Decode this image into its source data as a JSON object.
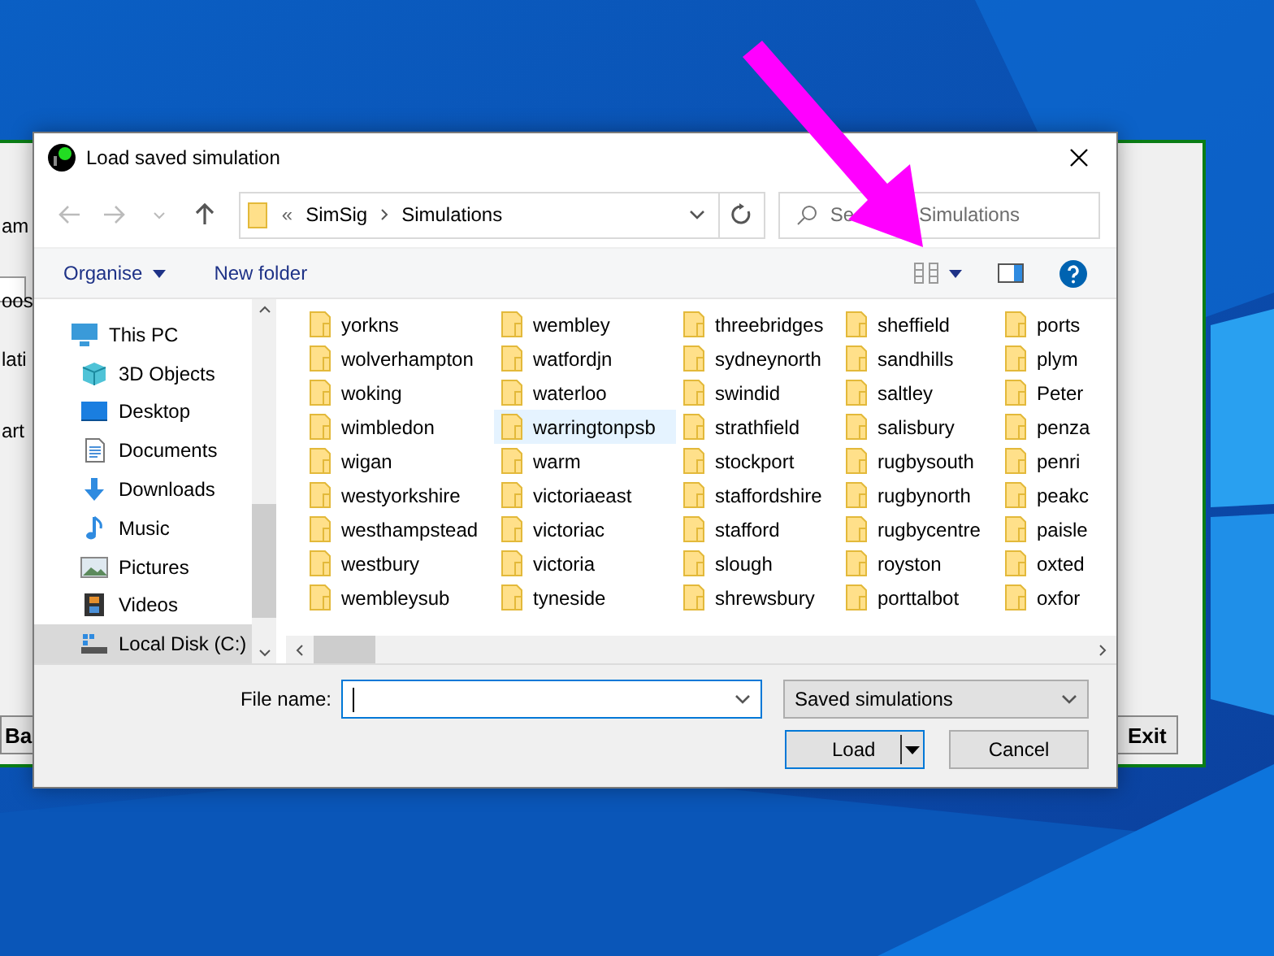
{
  "background_window": {
    "fragments": [
      "am",
      "oos",
      "lati",
      "art"
    ],
    "buttons": [
      "Ba",
      "Exit"
    ]
  },
  "dialog": {
    "title": "Load saved simulation",
    "address": {
      "prefix": "«",
      "path": [
        "SimSig",
        "Simulations"
      ]
    },
    "search": {
      "placeholder": [
        "Se",
        "Simulations"
      ]
    },
    "toolbar": {
      "organise": "Organise",
      "new_folder": "New folder"
    },
    "navigation": [
      {
        "label": "This PC",
        "kind": "pc",
        "selected": false,
        "children": [
          {
            "label": "3D Objects",
            "kind": "objects",
            "selected": false
          },
          {
            "label": "Desktop",
            "kind": "desktop",
            "selected": false
          },
          {
            "label": "Documents",
            "kind": "documents",
            "selected": false
          },
          {
            "label": "Downloads",
            "kind": "downloads",
            "selected": false
          },
          {
            "label": "Music",
            "kind": "music",
            "selected": false
          },
          {
            "label": "Pictures",
            "kind": "pictures",
            "selected": false
          },
          {
            "label": "Videos",
            "kind": "videos",
            "selected": false
          },
          {
            "label": "Local Disk (C:)",
            "kind": "disk",
            "selected": true
          }
        ]
      }
    ],
    "folders": [
      {
        "name": "yorkns",
        "highlighted": false
      },
      {
        "name": "wolverhampton",
        "highlighted": false
      },
      {
        "name": "woking",
        "highlighted": false
      },
      {
        "name": "wimbledon",
        "highlighted": false
      },
      {
        "name": "wigan",
        "highlighted": false
      },
      {
        "name": "westyorkshire",
        "highlighted": false
      },
      {
        "name": "westhampstead",
        "highlighted": false
      },
      {
        "name": "westbury",
        "highlighted": false
      },
      {
        "name": "wembleysub",
        "highlighted": false
      },
      {
        "name": "wembley",
        "highlighted": false
      },
      {
        "name": "watfordjn",
        "highlighted": false
      },
      {
        "name": "waterloo",
        "highlighted": false
      },
      {
        "name": "warringtonpsb",
        "highlighted": true
      },
      {
        "name": "warm",
        "highlighted": false
      },
      {
        "name": "victoriaeast",
        "highlighted": false
      },
      {
        "name": "victoriac",
        "highlighted": false
      },
      {
        "name": "victoria",
        "highlighted": false
      },
      {
        "name": "tyneside",
        "highlighted": false
      },
      {
        "name": "threebridges",
        "highlighted": false
      },
      {
        "name": "sydneynorth",
        "highlighted": false
      },
      {
        "name": "swindid",
        "highlighted": false
      },
      {
        "name": "strathfield",
        "highlighted": false
      },
      {
        "name": "stockport",
        "highlighted": false
      },
      {
        "name": "staffordshire",
        "highlighted": false
      },
      {
        "name": "stafford",
        "highlighted": false
      },
      {
        "name": "slough",
        "highlighted": false
      },
      {
        "name": "shrewsbury",
        "highlighted": false
      },
      {
        "name": "sheffield",
        "highlighted": false
      },
      {
        "name": "sandhills",
        "highlighted": false
      },
      {
        "name": "saltley",
        "highlighted": false
      },
      {
        "name": "salisbury",
        "highlighted": false
      },
      {
        "name": "rugbysouth",
        "highlighted": false
      },
      {
        "name": "rugbynorth",
        "highlighted": false
      },
      {
        "name": "rugbycentre",
        "highlighted": false
      },
      {
        "name": "royston",
        "highlighted": false
      },
      {
        "name": "porttalbot",
        "highlighted": false
      },
      {
        "name": "ports",
        "highlighted": false
      },
      {
        "name": "plym",
        "highlighted": false
      },
      {
        "name": "Peter",
        "highlighted": false
      },
      {
        "name": "penza",
        "highlighted": false
      },
      {
        "name": "penri",
        "highlighted": false
      },
      {
        "name": "peakc",
        "highlighted": false
      },
      {
        "name": "paisle",
        "highlighted": false
      },
      {
        "name": "oxted",
        "highlighted": false
      },
      {
        "name": "oxfor",
        "highlighted": false
      }
    ],
    "file_name": {
      "label": "File name:"
    },
    "file_type": "Saved simulations",
    "buttons": [
      "Load",
      "Cancel"
    ]
  }
}
